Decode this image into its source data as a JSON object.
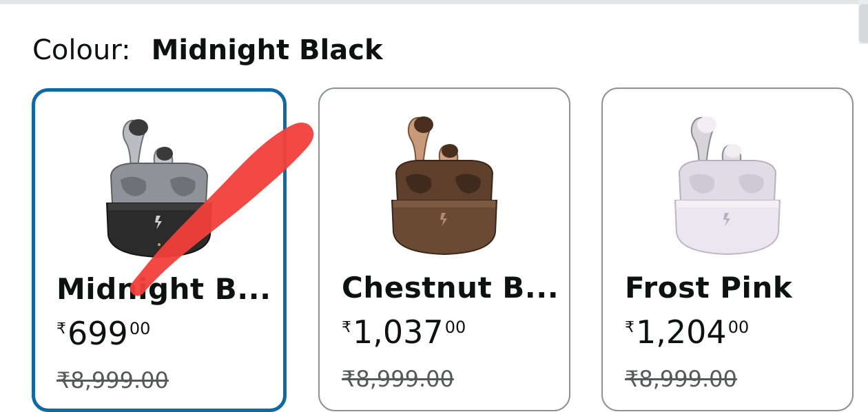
{
  "colour_selector": {
    "label": "Colour:",
    "selected_value": "Midnight Black"
  },
  "swatches": [
    {
      "name": "Midnight B...",
      "price_symbol": "₹",
      "price_whole": "699",
      "price_fraction": "00",
      "mrp": "₹8,999.00",
      "selected": true,
      "body_color": "#2b2b2b",
      "lid_color": "#9a9a9a"
    },
    {
      "name": "Chestnut B...",
      "price_symbol": "₹",
      "price_whole": "1,037",
      "price_fraction": "00",
      "mrp": "₹8,999.00",
      "selected": false,
      "body_color": "#5a3a26",
      "lid_color": "#7b5a44"
    },
    {
      "name": "Frost Pink",
      "price_symbol": "₹",
      "price_whole": "1,204",
      "price_fraction": "00",
      "mrp": "₹8,999.00",
      "selected": false,
      "body_color": "#e9e3ec",
      "lid_color": "#d9d2de"
    }
  ],
  "colors": {
    "selected_border": "#0e6aa7",
    "unselected_border": "#8d9096",
    "annotation_stroke": "#f2403a"
  },
  "icons": {
    "annotation": "red-strike-mark"
  }
}
